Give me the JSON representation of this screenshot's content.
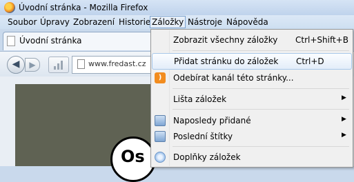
{
  "window": {
    "title": "Úvodní stránka - Mozilla Firefox"
  },
  "menubar": {
    "items": [
      "Soubor",
      "Úpravy",
      "Zobrazení",
      "Historie",
      "Záložky",
      "Nástroje",
      "Nápověda"
    ]
  },
  "tab": {
    "label": "Úvodní stránka"
  },
  "navbar": {
    "url": "www.fredast.cz"
  },
  "content": {
    "logo_text": "Os"
  },
  "bookmarks_menu": {
    "items": [
      {
        "label": "Zobrazit všechny záložky",
        "shortcut": "Ctrl+Shift+B"
      },
      {
        "label": "Přidat stránku do záložek",
        "shortcut": "Ctrl+D"
      },
      {
        "label": "Odebírat kanál této stránky...",
        "icon": "rss-icon"
      },
      {
        "label": "Lišta záložek",
        "icon": "folder-icon"
      },
      {
        "label": "Naposledy přidané",
        "icon": "smart-folder-icon"
      },
      {
        "label": "Poslední štítky",
        "icon": "smart-folder-icon"
      },
      {
        "label": "Doplňky záložek",
        "icon": "addon-icon"
      }
    ]
  }
}
